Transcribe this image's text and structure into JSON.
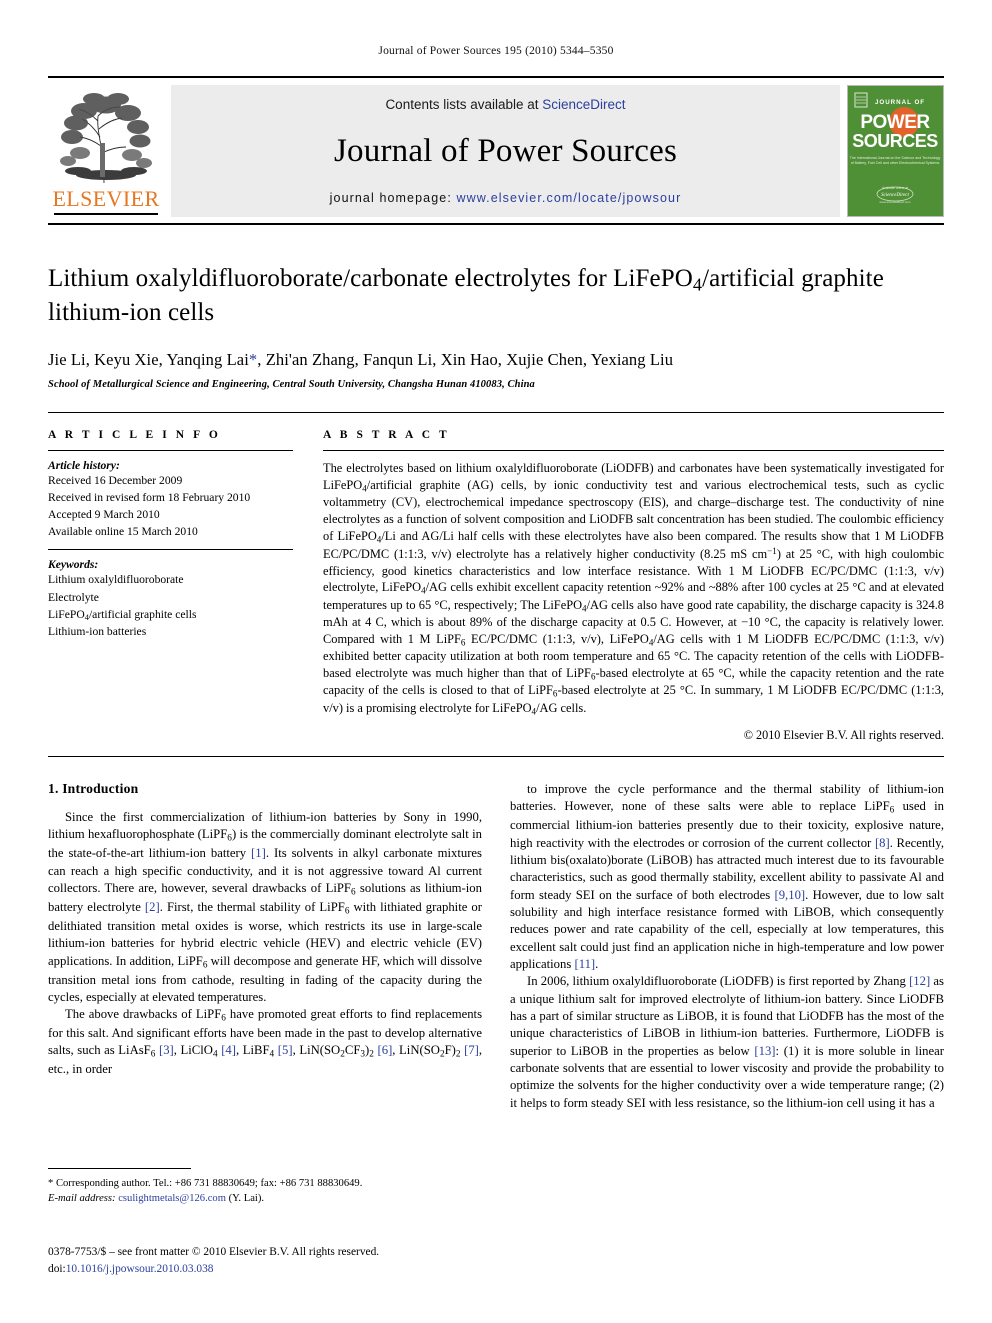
{
  "running_head": "Journal of Power Sources 195 (2010) 5344–5350",
  "masthead": {
    "contents_prefix": "Contents lists available at ",
    "sciencedirect": "ScienceDirect",
    "journal_name": "Journal of Power Sources",
    "homepage_prefix": "journal homepage: ",
    "homepage_url": "www.elsevier.com/locate/jpowsour",
    "publisher": "ELSEVIER",
    "cover": {
      "top_label": "JOURNAL OF",
      "title_line1": "POWER",
      "title_line2": "SOURCES",
      "subtitle": "The International Journal on the Science and Technology of Battery, Fuel Cell and other Electrochemical Systems",
      "footer": "ScienceDirect"
    },
    "accent_orange": "#E87722",
    "link_blue": "#2b3f9e",
    "cover_green": "#4f8f35",
    "cover_orange": "#e2622a"
  },
  "article": {
    "title": "Lithium oxalyldifluoroborate/carbonate electrolytes for LiFePO<sub>4</sub>/artificial graphite lithium-ion cells",
    "authors": "Jie Li, Keyu Xie, Yanqing Lai<span class=\"corr-star\">*</span>, Zhi'an Zhang, Fanqun Li, Xin Hao, Xujie Chen, Yexiang Liu",
    "affiliation": "School of Metallurgical Science and Engineering, Central South University, Changsha Hunan 410083, China"
  },
  "article_info": {
    "label": "A R T I C L E    I N F O",
    "history_heading": "Article history:",
    "history": [
      "Received 16 December 2009",
      "Received in revised form 18 February 2010",
      "Accepted 9 March 2010",
      "Available online 15 March 2010"
    ],
    "keywords_heading": "Keywords:",
    "keywords": [
      "Lithium oxalyldifluoroborate",
      "Electrolyte",
      "LiFePO<sub>4</sub>/artificial graphite cells",
      "Lithium-ion batteries"
    ]
  },
  "abstract": {
    "label": "A B S T R A C T",
    "text": "The electrolytes based on lithium oxalyldifluoroborate (LiODFB) and carbonates have been systematically investigated for LiFePO<sub>4</sub>/artificial graphite (AG) cells, by ionic conductivity test and various electrochemical tests, such as cyclic voltammetry (CV), electrochemical impedance spectroscopy (EIS), and charge–discharge test. The conductivity of nine electrolytes as a function of solvent composition and LiODFB salt concentration has been studied. The coulombic efficiency of LiFePO<sub>4</sub>/Li and AG/Li half cells with these electrolytes have also been compared. The results show that 1 M LiODFB EC/PC/DMC (1:1:3, v/v) electrolyte has a relatively higher conductivity (8.25 mS cm<sup>−1</sup>) at 25 °C, with high coulombic efficiency, good kinetics characteristics and low interface resistance. With 1 M LiODFB EC/PC/DMC (1:1:3, v/v) electrolyte, LiFePO<sub>4</sub>/AG cells exhibit excellent capacity retention ~92% and ~88% after 100 cycles at 25 °C and at elevated temperatures up to 65 °C, respectively; The LiFePO<sub>4</sub>/AG cells also have good rate capability, the discharge capacity is 324.8 mAh at 4 C, which is about 89% of the discharge capacity at 0.5 C. However, at −10 °C, the capacity is relatively lower. Compared with 1 M LiPF<sub>6</sub> EC/PC/DMC (1:1:3, v/v), LiFePO<sub>4</sub>/AG cells with 1 M LiODFB EC/PC/DMC (1:1:3, v/v) exhibited better capacity utilization at both room temperature and 65 °C. The capacity retention of the cells with LiODFB-based electrolyte was much higher than that of LiPF<sub>6</sub>-based electrolyte at 65 °C, while the capacity retention and the rate capacity of the cells is closed to that of LiPF<sub>6</sub>-based electrolyte at 25 °C. In summary, 1 M LiODFB EC/PC/DMC (1:1:3, v/v) is a promising electrolyte for LiFePO<sub>4</sub>/AG cells.",
    "copyright": "© 2010 Elsevier B.V. All rights reserved."
  },
  "body": {
    "section_number_title": "1.  Introduction",
    "left_paragraphs": [
      "Since the first commercialization of lithium-ion batteries by Sony in 1990, lithium hexafluorophosphate (LiPF<sub>6</sub>) is the commercially dominant electrolyte salt in the state-of-the-art lithium-ion battery <span class=\"ref\">[1]</span>. Its solvents in alkyl carbonate mixtures can reach a high specific conductivity, and it is not aggressive toward Al current collectors. There are, however, several drawbacks of LiPF<sub>6</sub> solutions as lithium-ion battery electrolyte <span class=\"ref\">[2]</span>. First, the thermal stability of LiPF<sub>6</sub> with lithiated graphite or delithiated transition metal oxides is worse, which restricts its use in large-scale lithium-ion batteries for hybrid electric vehicle (HEV) and electric vehicle (EV) applications. In addition, LiPF<sub>6</sub> will decompose and generate HF, which will dissolve transition metal ions from cathode, resulting in fading of the capacity during the cycles, especially at elevated temperatures.",
      "The above drawbacks of LiPF<sub>6</sub> have promoted great efforts to find replacements for this salt. And significant efforts have been made in the past to develop alternative salts, such as LiAsF<sub>6</sub> <span class=\"ref\">[3]</span>, LiClO<sub>4</sub> <span class=\"ref\">[4]</span>, LiBF<sub>4</sub> <span class=\"ref\">[5]</span>, LiN(SO<sub>2</sub>CF<sub>3</sub>)<sub>2</sub> <span class=\"ref\">[6]</span>, LiN(SO<sub>2</sub>F)<sub>2</sub> <span class=\"ref\">[7]</span>, etc., in order"
    ],
    "right_paragraphs": [
      "to improve the cycle performance and the thermal stability of lithium-ion batteries. However, none of these salts were able to replace LiPF<sub>6</sub> used in commercial lithium-ion batteries presently due to their toxicity, explosive nature, high reactivity with the electrodes or corrosion of the current collector <span class=\"ref\">[8]</span>. Recently, lithium bis(oxalato)borate (LiBOB) has attracted much interest due to its favourable characteristics, such as good thermally stability, excellent ability to passivate Al and form steady SEI on the surface of both electrodes <span class=\"ref\">[9,10]</span>. However, due to low salt solubility and high interface resistance formed with LiBOB, which consequently reduces power and rate capability of the cell, especially at low temperatures, this excellent salt could just find an application niche in high-temperature and low power applications <span class=\"ref\">[11]</span>.",
      "In 2006, lithium oxalyldifluoroborate (LiODFB) is first reported by Zhang <span class=\"ref\">[12]</span> as a unique lithium salt for improved electrolyte of lithium-ion battery. Since LiODFB has a part of similar structure as LiBOB, it is found that LiODFB has the most of the unique characteristics of LiBOB in lithium-ion batteries. Furthermore, LiODFB is superior to LiBOB in the properties as below <span class=\"ref\">[13]</span>: (1) it is more soluble in linear carbonate solvents that are essential to lower viscosity and provide the probability to optimize the solvents for the higher conductivity over a wide temperature range; (2) it helps to form steady SEI with less resistance, so the lithium-ion cell using it has a"
    ]
  },
  "footnotes": {
    "corresponding": "* Corresponding author. Tel.: +86 731 88830649; fax: +86 731 88830649.",
    "email_label": "E-mail address:",
    "email": "csulightmetals@126.com",
    "email_suffix": "(Y. Lai)."
  },
  "imprint": {
    "issn_line": "0378-7753/$ – see front matter © 2010 Elsevier B.V. All rights reserved.",
    "doi_label": "doi:",
    "doi": "10.1016/j.jpowsour.2010.03.038"
  }
}
